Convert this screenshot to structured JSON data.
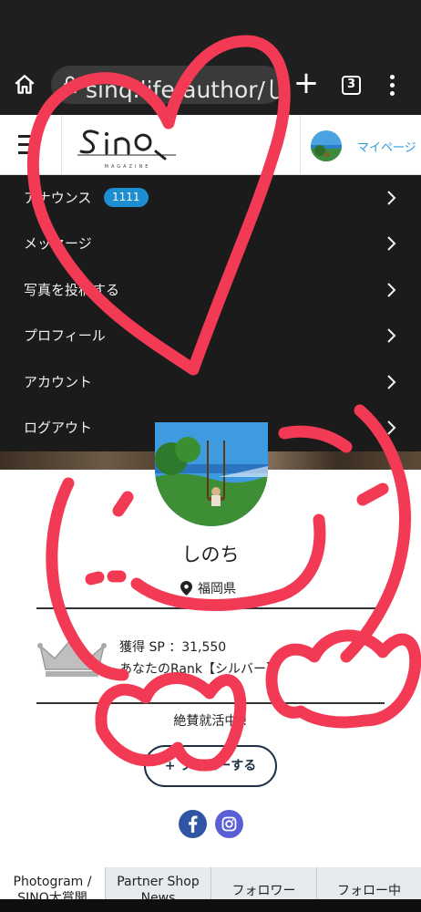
{
  "browser": {
    "url": "sinq.life/author/しの",
    "tab_count": "3"
  },
  "header": {
    "logo_text": "Sinq",
    "logo_sub": "MAGAZINE",
    "mypage_label": "マイページ"
  },
  "menu": {
    "items": [
      {
        "label": "アナウンス",
        "badge": "1111"
      },
      {
        "label": "メッセージ"
      },
      {
        "label": "写真を投稿する"
      },
      {
        "label": "プロフィール"
      },
      {
        "label": "アカウント"
      },
      {
        "label": "ログアウト"
      }
    ]
  },
  "profile": {
    "name": "しのち",
    "location": "福岡県",
    "sp_text": "獲得 SP ：31,550",
    "rank_text": "あなたのRank【シルバー】",
    "tagline": "絶賛就活中!!",
    "follow_label": "+ フォローする"
  },
  "tabs": [
    {
      "line1": "Photogram /",
      "line2": "SINQ大賞開"
    },
    {
      "line1": "Partner Shop",
      "line2": "News"
    },
    {
      "line1": "フォロワー",
      "line2": ""
    },
    {
      "line1": "フォロー中",
      "line2": ""
    }
  ],
  "colors": {
    "accent_blue": "#2a9bd5",
    "badge_blue": "#1d8fd0",
    "menu_bg": "#1b1b1b",
    "scribble_red": "#f23a55",
    "follow_navy": "#1e3046",
    "facebook": "#2f55a4",
    "instagram": "#5b5fd6"
  },
  "icons": [
    "home-icon",
    "lock-icon",
    "plus-icon",
    "tab-switcher-icon",
    "more-vert-icon",
    "hamburger-icon",
    "chevron-right-icon",
    "map-pin-icon",
    "crown-icon",
    "facebook-icon",
    "instagram-icon"
  ]
}
